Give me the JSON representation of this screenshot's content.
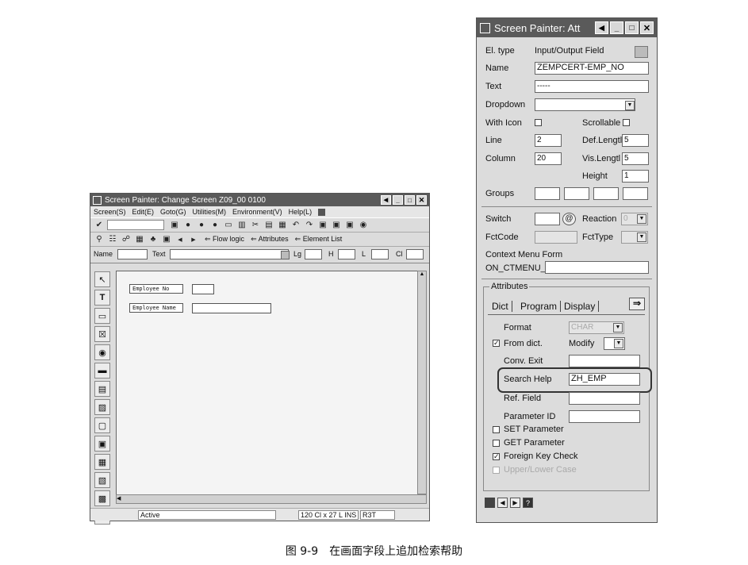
{
  "left_window": {
    "title": "Screen Painter:  Change Screen Z09_00 0100",
    "menu": [
      "Screen(S)",
      "Edit(E)",
      "Goto(G)",
      "Utilities(M)",
      "Environment(V)",
      "Help(L)"
    ],
    "toolbar2": {
      "flow_logic": "Flow logic",
      "attributes": "Attributes",
      "element_list": "Element List"
    },
    "attr_bar": {
      "name": "Name",
      "text": "Text",
      "lg": "Lg",
      "h": "H",
      "l": "L",
      "cl": "Cl"
    },
    "canvas": {
      "employee_no_label": "Employee No",
      "employee_name_label": "Employee Name"
    },
    "status": {
      "state": "Active",
      "pos": "120 Cl x 27 L INS",
      "sys": "R3T"
    }
  },
  "right_window": {
    "title": "Screen Painter: Att",
    "el_type": {
      "label": "El. type",
      "value": "Input/Output Field"
    },
    "name": {
      "label": "Name",
      "value": "ZEMPCERT-EMP_NO"
    },
    "text": {
      "label": "Text",
      "value": "-----"
    },
    "dropdown": {
      "label": "Dropdown",
      "value": ""
    },
    "with_icon": {
      "label": "With Icon"
    },
    "scrollable": {
      "label": "Scrollable"
    },
    "line": {
      "label": "Line",
      "value": "2"
    },
    "def_length": {
      "label": "Def.Lengtl",
      "value": "5"
    },
    "column": {
      "label": "Column",
      "value": "20"
    },
    "vis_length": {
      "label": "Vis.Lengtl",
      "value": "5"
    },
    "height": {
      "label": "Height",
      "value": "1"
    },
    "groups": {
      "label": "Groups"
    },
    "switch": {
      "label": "Switch"
    },
    "reaction": {
      "label": "Reaction",
      "value": "0"
    },
    "fctcode": {
      "label": "FctCode"
    },
    "fcttype": {
      "label": "FctType"
    },
    "context_menu": {
      "label": "Context Menu Form",
      "prefix": "ON_CTMENU_"
    },
    "attributes_group": "Attributes",
    "tabs": [
      "Dict",
      "Program",
      "Display"
    ],
    "format": {
      "label": "Format",
      "value": "CHAR"
    },
    "from_dict": {
      "label": "From dict.",
      "checked": true
    },
    "modify": {
      "label": "Modify"
    },
    "conv_exit": {
      "label": "Conv. Exit"
    },
    "search_help": {
      "label": "Search Help",
      "value": "ZH_EMP"
    },
    "ref_field": {
      "label": "Ref. Field"
    },
    "parameter_id": {
      "label": "Parameter ID"
    },
    "set_parameter": {
      "label": "SET Parameter",
      "checked": false
    },
    "get_parameter": {
      "label": "GET Parameter",
      "checked": false
    },
    "foreign_key_check": {
      "label": "Foreign Key Check",
      "checked": true
    },
    "upper_lower": {
      "label": "Upper/Lower Case",
      "checked": false
    }
  },
  "caption": "图 9-9　在画面字段上追加检索帮助",
  "colors": {
    "highlight": "#333333",
    "titlebar": "#5a5a5a"
  }
}
